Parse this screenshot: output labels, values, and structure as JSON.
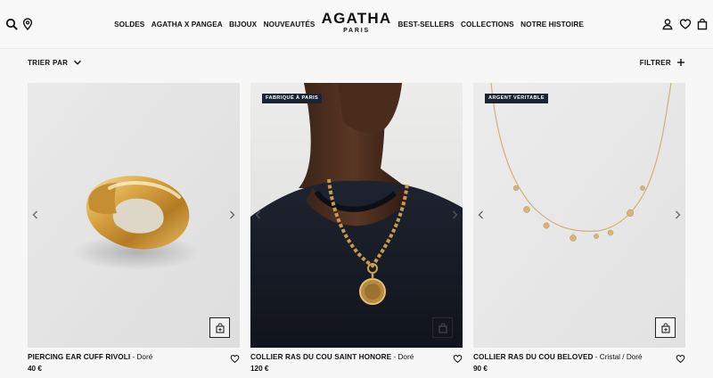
{
  "header": {
    "left_icons": [
      "search-icon",
      "location-pin-icon"
    ],
    "nav_left": [
      "SOLDES",
      "AGATHA X PANGEA",
      "BIJOUX",
      "NOUVEAUTÉS"
    ],
    "nav_right": [
      "BEST-SELLERS",
      "COLLECTIONS",
      "NOTRE HISTOIRE"
    ],
    "logo": {
      "name": "AGATHA",
      "subtitle": "PARIS"
    },
    "right_icons": [
      "account-icon",
      "wishlist-heart-icon",
      "shopping-bag-icon"
    ]
  },
  "toolbar": {
    "sort_label": "TRIER PAR",
    "filter_label": "FILTRER"
  },
  "products": [
    {
      "name": "PIERCING EAR CUFF RIVOLI",
      "variant": " - Doré",
      "price": "40 €",
      "badge": "",
      "image": "gold ear cuff on light grey background"
    },
    {
      "name": "COLLIER RAS DU COU SAINT HONORE",
      "variant": " - Doré",
      "price": "120 €",
      "badge": "FABRIQUÉ À PARIS",
      "image": "model wearing gold chain necklace with medallion"
    },
    {
      "name": "COLLIER RAS DU COU BELOVED",
      "variant": " - Cristal / Doré",
      "price": "90 €",
      "badge": "ARGENT VÉRITABLE",
      "image": "gold crystal charm necklace on light background"
    }
  ],
  "colors": {
    "badge_bg": "#1b2433",
    "text": "#111111",
    "page_bg": "#f7f7f7"
  }
}
